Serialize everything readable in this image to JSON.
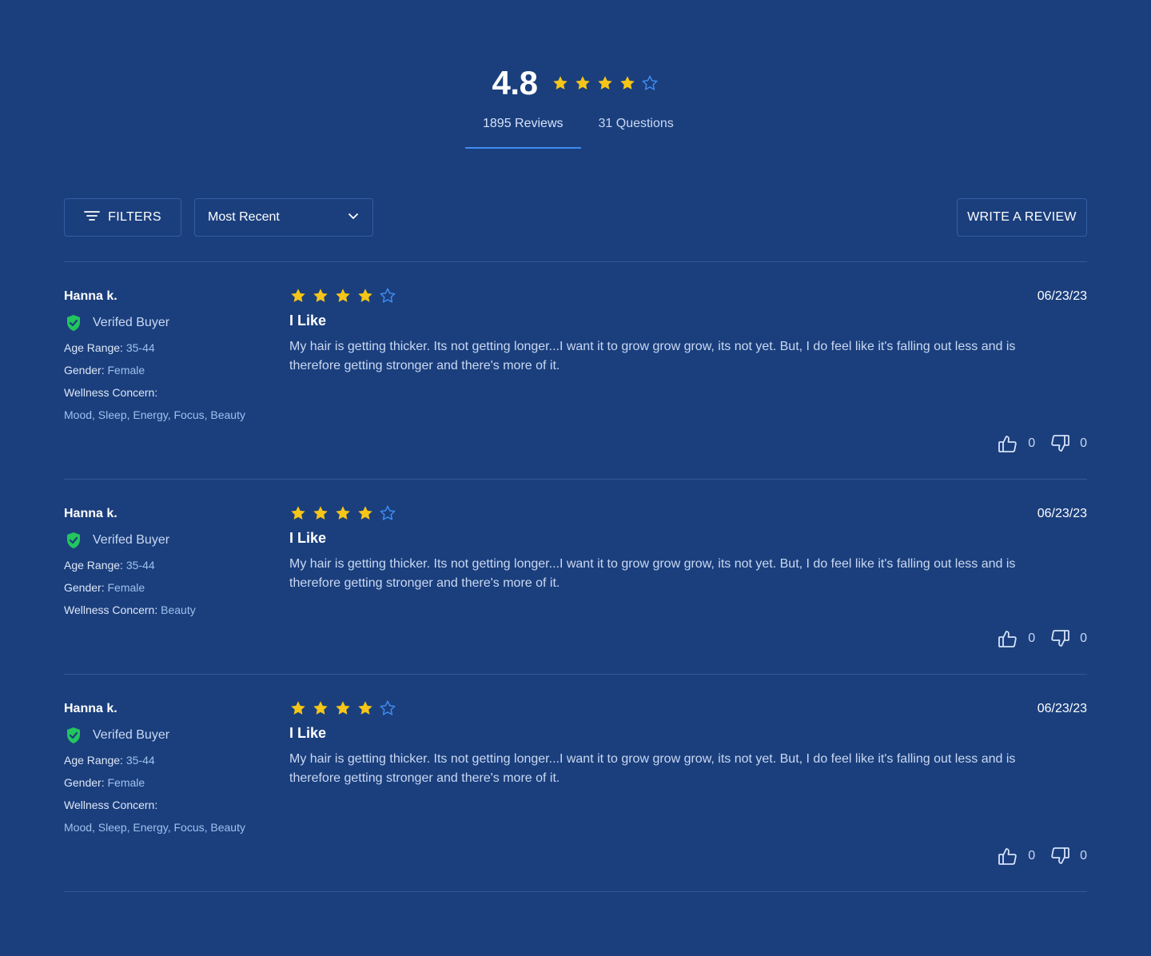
{
  "colors": {
    "background": "#1b3f7d",
    "star_filled": "#f5c518",
    "star_empty": "#3f8cf0",
    "verified_green": "#22c55e",
    "accent": "#3f8cf0"
  },
  "summary": {
    "average": "4.8",
    "rating": 4,
    "max_rating": 5
  },
  "tabs": [
    {
      "label": "1895 Reviews",
      "active": true
    },
    {
      "label": "31 Questions",
      "active": false
    }
  ],
  "toolbar": {
    "filters_label": "FILTERS",
    "filters_icon": "filter-lines-icon",
    "sort_label": "Most Recent",
    "sort_icon": "chevron-down-icon",
    "write_label": "WRITE A REVIEW"
  },
  "reviews": [
    {
      "author": "Hanna k.",
      "verified_label": "Verifed Buyer",
      "age_label": "Age Range:",
      "age_value": "35-44",
      "gender_label": "Gender:",
      "gender_value": "Female",
      "concern_label": "Wellness Concern:",
      "concern_value": "",
      "concern_list": "Mood, Sleep, Energy, Focus, Beauty",
      "rating": 4,
      "title": "I Like",
      "body": "My hair is getting thicker. Its not getting longer...I want it to grow grow grow, its not yet. But, I do feel like it's falling out less and is therefore getting stronger and there's more of it.",
      "date": "06/23/23",
      "helpful_up": "0",
      "helpful_down": "0"
    },
    {
      "author": "Hanna k.",
      "verified_label": "Verifed Buyer",
      "age_label": "Age Range:",
      "age_value": "35-44",
      "gender_label": "Gender:",
      "gender_value": "Female",
      "concern_label": "Wellness Concern:",
      "concern_value": "Beauty",
      "concern_list": "",
      "rating": 4,
      "title": "I Like",
      "body": "My hair is getting thicker. Its not getting longer...I want it to grow grow grow, its not yet. But, I do feel like it's falling out less and is therefore getting stronger and there's more of it.",
      "date": "06/23/23",
      "helpful_up": "0",
      "helpful_down": "0"
    },
    {
      "author": "Hanna k.",
      "verified_label": "Verifed Buyer",
      "age_label": "Age Range:",
      "age_value": "35-44",
      "gender_label": "Gender:",
      "gender_value": "Female",
      "concern_label": "Wellness Concern:",
      "concern_value": "",
      "concern_list": "Mood, Sleep, Energy, Focus, Beauty",
      "rating": 4,
      "title": "I Like",
      "body": "My hair is getting thicker. Its not getting longer...I want it to grow grow grow, its not yet. But, I do feel like it's falling out less and is therefore getting stronger and there's more of it.",
      "date": "06/23/23",
      "helpful_up": "0",
      "helpful_down": "0"
    }
  ]
}
